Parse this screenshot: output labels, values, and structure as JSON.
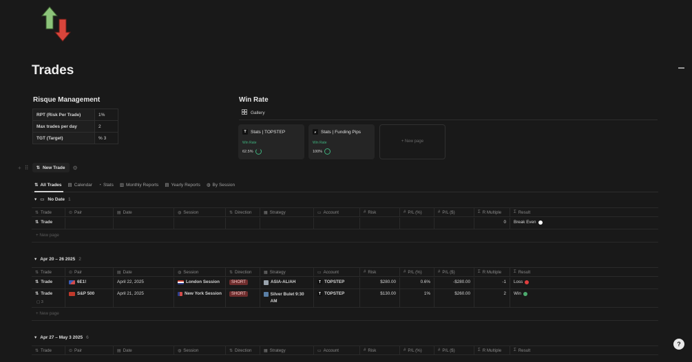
{
  "page": {
    "title": "Trades",
    "logo_icon": "up-down-arrows-icon"
  },
  "risk": {
    "title": "Risque Management",
    "rows": [
      {
        "label": "RPT (Risk Per Trade)",
        "value": "1%"
      },
      {
        "label": "Max trades per day",
        "value": "2"
      },
      {
        "label": "TGT (Target)",
        "value": "% 3"
      }
    ]
  },
  "winrate": {
    "title": "Win Rate",
    "gallery_label": "Gallery",
    "cards": [
      {
        "title": "Stats | TOPSTEP",
        "icon_letter": "T",
        "label": "Win Rate",
        "value": "62.5%",
        "fraction": 0.625
      },
      {
        "title": "Stats | Funding Pips",
        "icon_letter": "F",
        "label": "Win Rate",
        "value": "100%",
        "fraction": 1.0
      }
    ],
    "new_page": "+ New page"
  },
  "db": {
    "new_trade": "New Trade",
    "tabs": [
      "All Trades",
      "Calendar",
      "Stats",
      "Monthly Reports",
      "Yearly Reports",
      "By Session"
    ],
    "headers": [
      "Trade",
      "Pair",
      "Date",
      "Session",
      "Direction",
      "Strategy",
      "Account",
      "Risk",
      "P/L (%)",
      "P/L ($)",
      "R Multiple",
      "Result"
    ],
    "new_page": "+ New page",
    "groups": [
      {
        "name": "No Date",
        "count": "1",
        "rows": [
          {
            "trade": "Trade",
            "pair": "",
            "date": "",
            "session": "",
            "direction": "",
            "strategy": "",
            "account": "",
            "risk": "",
            "pl_pct": "",
            "pl_usd": "",
            "r": "0",
            "result": "Break Even",
            "result_color": "#ffffff"
          }
        ]
      },
      {
        "name": "Apr 20 – 26 2025",
        "count": "2",
        "rows": [
          {
            "trade": "Trade",
            "pair": "6E1!",
            "date": "April 22, 2025",
            "session": "London Session",
            "direction": "SHORT",
            "strategy": "ASIA-AL/AH",
            "account": "TOPSTEP",
            "risk": "$280.00",
            "pl_pct": "0.6%",
            "pl_usd": "-$280.00",
            "r": "-1",
            "result": "Loss",
            "result_color": "#e03e3e"
          },
          {
            "trade": "Trade",
            "pair": "S&P 500",
            "date": "April 21, 2025",
            "session": "New York Session",
            "direction": "SHORT",
            "strategy": "Silver Bulet 9:30 AM",
            "account": "TOPSTEP",
            "risk": "$130.00",
            "pl_pct": "1%",
            "pl_usd": "$260.00",
            "r": "2",
            "result": "Win",
            "result_color": "#4dab6e",
            "comments": "3"
          }
        ]
      },
      {
        "name": "Apr 27 – May 3 2025",
        "count": "6"
      }
    ]
  },
  "help_icon": "help-icon"
}
